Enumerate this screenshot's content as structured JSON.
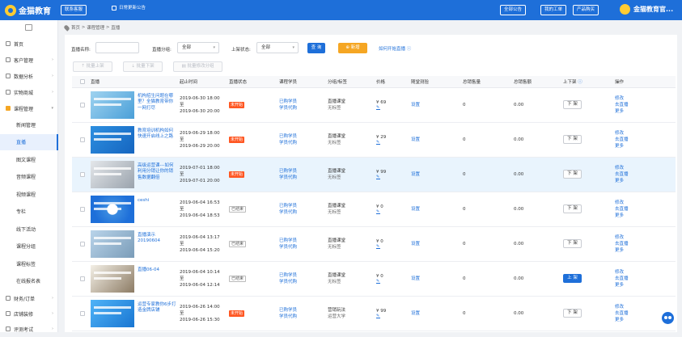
{
  "header": {
    "logo_text": "金猫教育",
    "contact_label": "联系客服",
    "notice_label": "日常更新公告",
    "all_notices_label": "全部公告",
    "my_tickets_label": "我的工单",
    "purchase_label": "产品购买",
    "org_name": "金猫教育官..."
  },
  "sidebar": {
    "items": [
      {
        "label": "首页",
        "has_arrow": false
      },
      {
        "label": "客户管理",
        "has_arrow": true
      },
      {
        "label": "数据分析",
        "has_arrow": true
      },
      {
        "label": "实物商城",
        "has_arrow": true
      },
      {
        "label": "课程管理",
        "has_arrow": true,
        "open": true
      }
    ],
    "sub_items": [
      "新闻管理",
      "直播",
      "图文课程",
      "音频课程",
      "视频课程",
      "专栏",
      "线下活动",
      "课程分组",
      "课程标签",
      "在线报名表"
    ],
    "active_sub": "直播",
    "bottom_items": [
      "财务/订单",
      "店铺装修",
      "评测考试"
    ]
  },
  "breadcrumb": {
    "home": "首页",
    "sep": ">",
    "level1": "课程管理",
    "level2": "直播"
  },
  "filters": {
    "name_label": "直播名称:",
    "name_value": "",
    "group_label": "直播分组:",
    "group_value": "全部",
    "status_label": "上架状态:",
    "status_value": "全部",
    "search_label": "查 询",
    "add_label": "新增",
    "help_label": "如何开始直播",
    "batch_on": "批量上架",
    "batch_off": "批量下架",
    "batch_group": "批量修改分组"
  },
  "table": {
    "headers": [
      "直播",
      "起止时间",
      "直播状态",
      "课程学员",
      "分组/标签",
      "价格",
      "随堂测验",
      "总销售量",
      "总销售额",
      "上下架",
      "操作"
    ],
    "rows": [
      {
        "title": "机构招生问题在哪里？全猫教育带你一网打尽",
        "start": "2019-06-30 18:00",
        "to": "至",
        "end": "2019-06-30 20:00",
        "status": "未开始",
        "status_type": "red",
        "students1": "已购学员",
        "students2": "学员代购",
        "group": "直播课堂",
        "tag": "无标签",
        "price": "¥ 69",
        "quiz": "设置",
        "sales": "0",
        "revenue": "0.00",
        "shelf": "下 架",
        "shelf_type": "down",
        "op1": "修改",
        "op2": "去直播",
        "op3": "更多"
      },
      {
        "title": "教育培训机构如何快速开启线上之路",
        "start": "2019-06-29 18:00",
        "to": "至",
        "end": "2019-06-29 20:00",
        "status": "未开始",
        "status_type": "red",
        "students1": "已购学员",
        "students2": "学员代购",
        "group": "直播课堂",
        "tag": "无标签",
        "price": "¥ 29",
        "quiz": "设置",
        "sales": "0",
        "revenue": "0.00",
        "shelf": "下 架",
        "shelf_type": "down",
        "op1": "修改",
        "op2": "去直播",
        "op3": "更多"
      },
      {
        "title": "高级运营课---如何利用分销让你的销售数据翻倍",
        "start": "2019-07-01 18:00",
        "to": "至",
        "end": "2019-07-01 20:00",
        "status": "未开始",
        "status_type": "red",
        "students1": "已购学员",
        "students2": "学员代购",
        "group": "直播课堂",
        "tag": "无标签",
        "price": "¥ 99",
        "quiz": "设置",
        "sales": "0",
        "revenue": "0.00",
        "shelf": "下 架",
        "shelf_type": "down",
        "op1": "修改",
        "op2": "去直播",
        "op3": "更多"
      },
      {
        "title": "ceshi",
        "start": "2019-06-04 16:53",
        "to": "至",
        "end": "2019-06-04 18:53",
        "status": "已结束",
        "status_type": "grey",
        "students1": "已购学员",
        "students2": "学员代购",
        "group": "直播课堂",
        "tag": "无标签",
        "price": "¥ 0",
        "quiz": "设置",
        "sales": "0",
        "revenue": "0.00",
        "shelf": "下 架",
        "shelf_type": "down",
        "op1": "修改",
        "op2": "去直播",
        "op3": "更多"
      },
      {
        "title": "直播演示20190604",
        "start": "2019-06-04 13:17",
        "to": "至",
        "end": "2019-06-04 15:20",
        "status": "已结束",
        "status_type": "grey",
        "students1": "已购学员",
        "students2": "学员代购",
        "group": "直播课堂",
        "tag": "无标签",
        "price": "¥ 0",
        "quiz": "设置",
        "sales": "0",
        "revenue": "0.00",
        "shelf": "下 架",
        "shelf_type": "down",
        "op1": "修改",
        "op2": "去直播",
        "op3": "更多"
      },
      {
        "title": "直播06-04",
        "start": "2019-06-04 10:14",
        "to": "至",
        "end": "2019-06-04 12:14",
        "status": "已结束",
        "status_type": "grey",
        "students1": "已购学员",
        "students2": "学员代购",
        "group": "直播课堂",
        "tag": "无标签",
        "price": "¥ 0",
        "quiz": "设置",
        "sales": "0",
        "revenue": "0.00",
        "shelf": "上 架",
        "shelf_type": "up",
        "op1": "修改",
        "op2": "去直播",
        "op3": "更多"
      },
      {
        "title": "运营专家教你6步打造金牌店铺",
        "start": "2019-06-26 14:00",
        "to": "至",
        "end": "2019-06-26 15:30",
        "status": "未开始",
        "status_type": "red",
        "students1": "已购学员",
        "students2": "学员代购",
        "group": "营销玩法",
        "tag": "运营大学",
        "price": "¥ 99",
        "quiz": "设置",
        "sales": "0",
        "revenue": "0.00",
        "shelf": "下 架",
        "shelf_type": "down",
        "op1": "修改",
        "op2": "去直播",
        "op3": "更多"
      }
    ]
  },
  "colors": {
    "primary": "#1e6fd9",
    "warning": "#f5a623",
    "danger": "#ff5722"
  }
}
